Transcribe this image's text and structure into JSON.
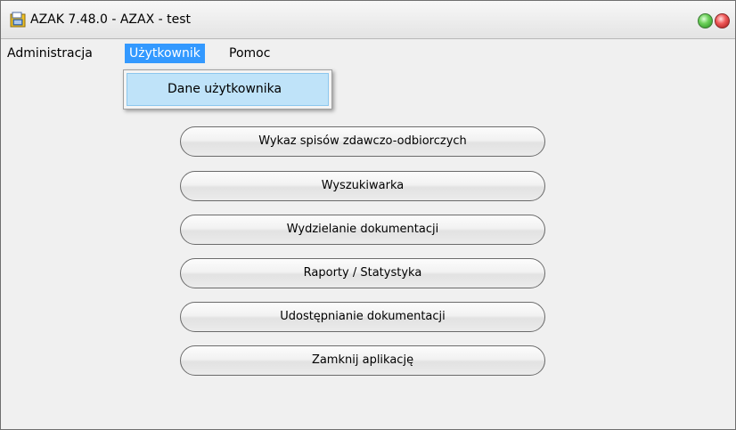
{
  "window": {
    "title": "AZAK 7.48.0 - AZAX - test"
  },
  "menubar": {
    "items": [
      "Administracja",
      "Użytkownik",
      "Pomoc"
    ],
    "active": "Użytkownik"
  },
  "dropdown": {
    "items": [
      "Dane użytkownika"
    ]
  },
  "main": {
    "buttons": [
      "Wykaz spisów zdawczo-odbiorczych",
      "Wyszukiwarka",
      "Wydzielanie dokumentacji",
      "Raporty / Statystyka",
      "Udostępnianie dokumentacji",
      "Zamknij aplikację"
    ]
  },
  "colors": {
    "menu_highlight": "#3399ff",
    "dropdown_highlight": "#bfe3f9",
    "window_bg": "#f0f0f0"
  },
  "icons": [
    "app-icon",
    "minimize-icon",
    "close-icon"
  ]
}
